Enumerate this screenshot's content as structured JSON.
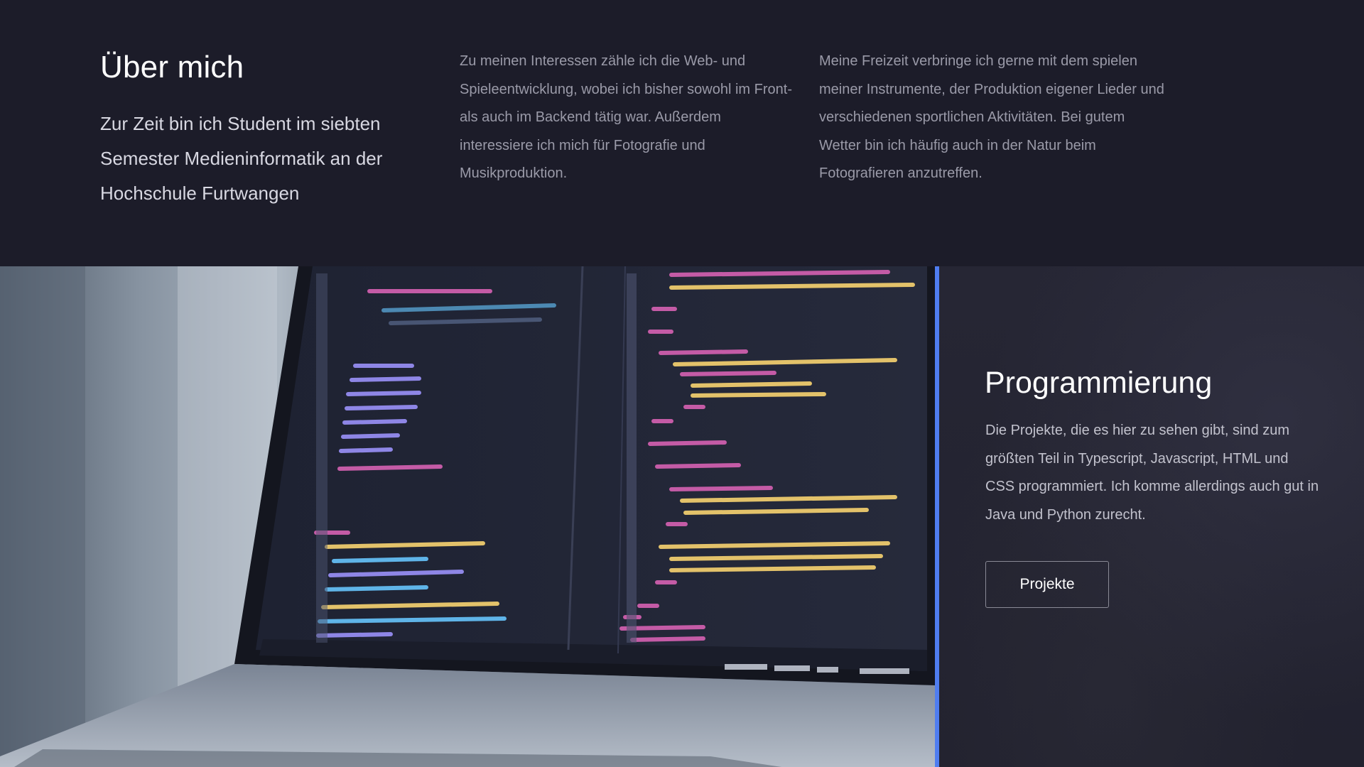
{
  "about": {
    "title": "Über mich",
    "lead": "Zur Zeit bin ich Student im siebten Semester Medieninformatik an der Hochschule Furtwangen",
    "interests": "Zu meinen Interessen zähle ich die Web- und Spieleentwicklung, wobei ich bisher sowohl im Front- als auch im Backend tätig war. Außerdem interessiere ich mich für Fotografie und Musikproduktion.",
    "freetime": "Meine Freizeit verbringe ich gerne mit dem spielen meiner Instrumente, der Produktion eigener Lieder und verschiedenen sportlichen Aktivitäten. Bei gutem Wetter bin ich häufig auch in der Natur beim Fotografieren anzutreffen."
  },
  "programming": {
    "title": "Programmierung",
    "text": "Die Projekte, die es hier zu sehen gibt, sind zum größten Teil in Typescript, Javascript, HTML und CSS programmiert. Ich komme allerdings auch gut in Java und Python zurecht.",
    "button_label": "Projekte"
  },
  "colors": {
    "background": "#1c1c29",
    "accent": "#4f7df0",
    "heading": "#ffffff",
    "body_text": "#9a9aa8"
  }
}
